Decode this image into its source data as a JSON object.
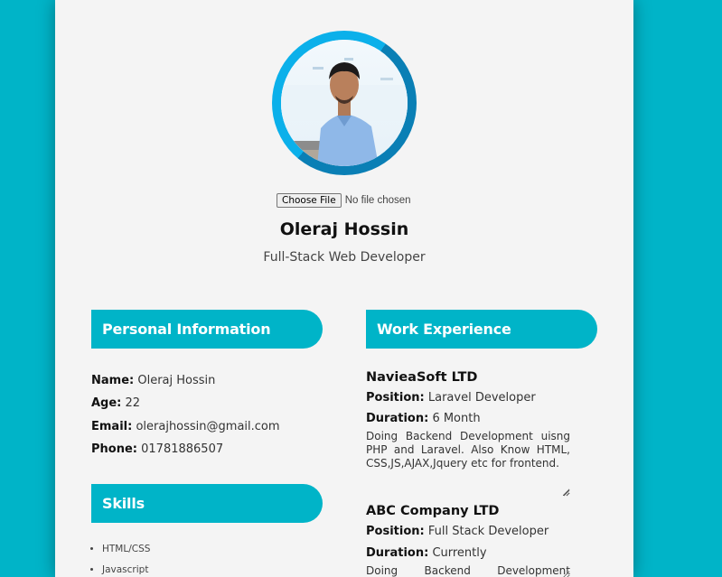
{
  "profile": {
    "name": "Oleraj Hossin",
    "role": "Full-Stack Web Developer",
    "file_button": "Choose File",
    "file_status": "No file chosen"
  },
  "personal": {
    "heading": "Personal Information",
    "fields": [
      {
        "label": "Name:",
        "value": "Oleraj Hossin"
      },
      {
        "label": "Age:",
        "value": "22"
      },
      {
        "label": "Email:",
        "value": "olerajhossin@gmail.com"
      },
      {
        "label": "Phone:",
        "value": "01781886507"
      }
    ]
  },
  "skills": {
    "heading": "Skills",
    "items": [
      "HTML/CSS",
      "Javascript"
    ]
  },
  "work": {
    "heading": "Work Experience",
    "jobs": [
      {
        "company": "NavieaSoft LTD",
        "position_label": "Position:",
        "position": "Laravel Developer",
        "duration_label": "Duration:",
        "duration": "6 Month",
        "description": "Doing Backend Development uisng PHP and Laravel. Also Know HTML, CSS,JS,AJAX,Jquery etc for frontend."
      },
      {
        "company": "ABC Company LTD",
        "position_label": "Position:",
        "position": "Full Stack Developer",
        "duration_label": "Duration:",
        "duration": "Currently",
        "description": "Doing Backend Development"
      }
    ]
  },
  "colors": {
    "accent": "#00b4c8",
    "ring_dark": "#0a7fb5",
    "ring_light": "#0bb0ea",
    "card": "#f4f4f4"
  }
}
